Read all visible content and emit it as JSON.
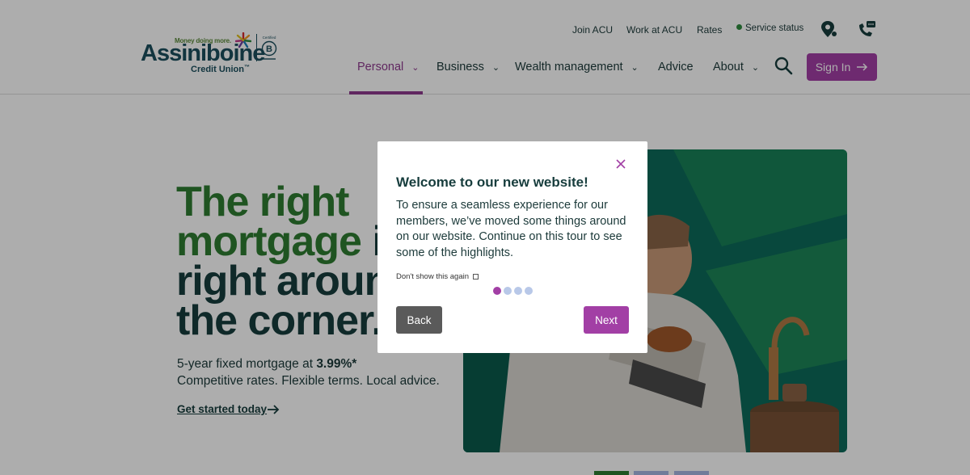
{
  "logo": {
    "tagline": "Money doing more.",
    "name": "Assiniboine",
    "sub": "Credit Union",
    "trademark": "™",
    "bcorp": "Certified B Corporation"
  },
  "utility_nav": {
    "join": "Join ACU",
    "work": "Work at ACU",
    "rates": "Rates",
    "service_status": "Service status"
  },
  "main_nav": {
    "personal": "Personal",
    "business": "Business",
    "wealth": "Wealth management",
    "advice": "Advice",
    "about": "About",
    "signin": "Sign In"
  },
  "hero": {
    "line1": "The right",
    "line2a": "mortgage ",
    "line2b": "is",
    "line3": "right around",
    "line4": "the corner.",
    "sub_prefix": "5-year fixed mortgage at ",
    "rate": "3.99%*",
    "sub_line2": "Competitive rates. Flexible terms. Local advice.",
    "cta": "Get started today"
  },
  "modal": {
    "title": "Welcome to our new website!",
    "body": "To ensure a seamless experience for our members, we’ve moved some things around on our website. Continue on this tour to see some of the highlights.",
    "dont_show": "Don't show this again",
    "back": "Back",
    "next": "Next",
    "steps_total": 4,
    "steps_current": 1
  },
  "colors": {
    "brand_purple": "#a23fa5",
    "brand_green": "#2e7d32",
    "dark_teal": "#173d3d"
  }
}
